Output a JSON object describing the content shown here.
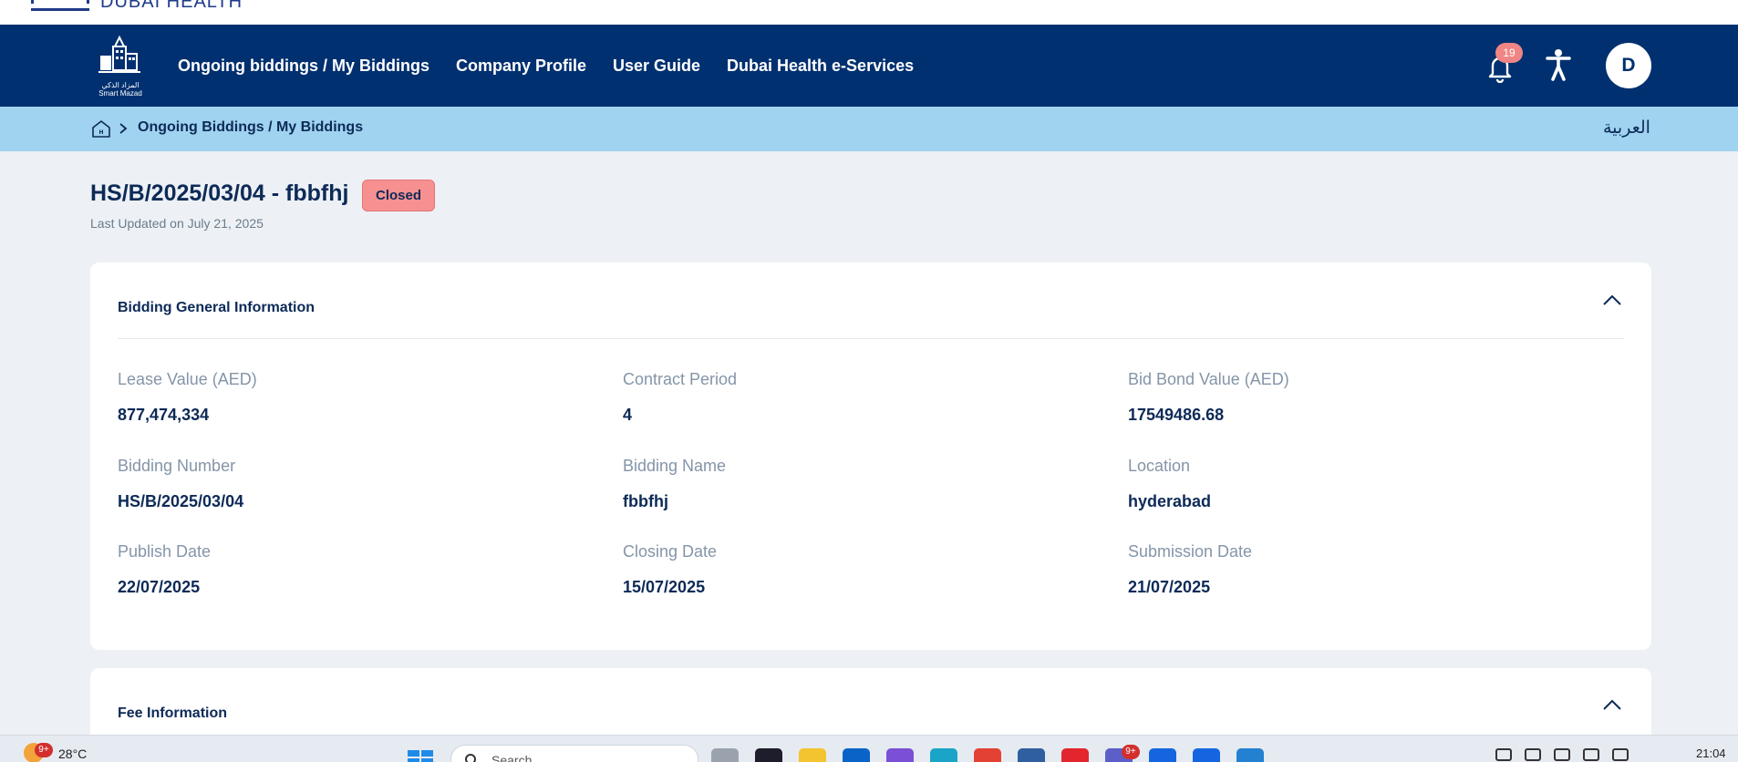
{
  "brand": {
    "name": "DUBAI HEALTH"
  },
  "nav": {
    "logo_text_ar": "المزاد الذكي",
    "logo_text_en": "Smart Mazad",
    "menu": [
      {
        "label": "Ongoing biddings / My Biddings"
      },
      {
        "label": "Company Profile"
      },
      {
        "label": "User Guide"
      },
      {
        "label": "Dubai Health e-Services"
      }
    ],
    "notifications_count": "19",
    "avatar_initial": "D"
  },
  "breadcrumb": {
    "current": "Ongoing Biddings / My Biddings",
    "language_toggle": "العربية"
  },
  "header": {
    "title": "HS/B/2025/03/04 - fbbfhj",
    "status": "Closed",
    "last_updated": "Last Updated on July 21, 2025"
  },
  "general_info": {
    "title": "Bidding General Information",
    "fields": [
      {
        "label": "Lease Value (AED)",
        "value": "877,474,334"
      },
      {
        "label": "Contract Period",
        "value": "4"
      },
      {
        "label": "Bid Bond Value (AED)",
        "value": "17549486.68"
      },
      {
        "label": "Bidding Number",
        "value": "HS/B/2025/03/04"
      },
      {
        "label": "Bidding Name",
        "value": "fbbfhj"
      },
      {
        "label": "Location",
        "value": "hyderabad"
      },
      {
        "label": "Publish Date",
        "value": "22/07/2025"
      },
      {
        "label": "Closing Date",
        "value": "15/07/2025"
      },
      {
        "label": "Submission Date",
        "value": "21/07/2025"
      }
    ]
  },
  "fee_info": {
    "title": "Fee Information"
  },
  "taskbar": {
    "weather_badge": "9+",
    "temperature": "28°C",
    "search_placeholder": "Search",
    "teams_badge": "9+",
    "time": "21:04"
  },
  "colors": {
    "nav_bg": "#003070",
    "breadcrumb_bg": "#9fd3f0",
    "status_closed": "#f79191",
    "text_primary": "#0d2a57",
    "text_label": "#8495a8"
  }
}
